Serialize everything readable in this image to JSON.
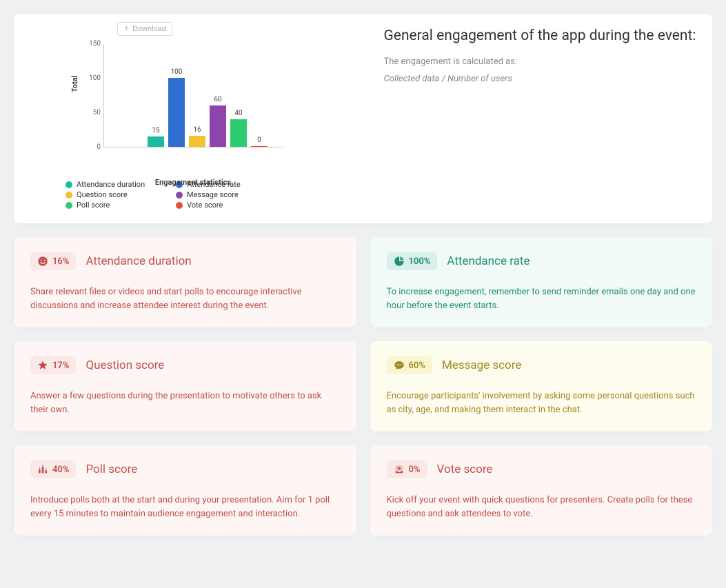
{
  "download_label": "Download",
  "header": {
    "title": "General engagement of the app during the event:",
    "subtitle": "The engagement is calculated as:",
    "formula": "Collected data / Number of users"
  },
  "chart_data": {
    "type": "bar",
    "title": "",
    "xlabel": "Engagement statistics",
    "ylabel": "Total",
    "ylim": [
      0,
      150
    ],
    "yticks": [
      0,
      50,
      100,
      150
    ],
    "series": [
      {
        "name": "Attendance duration",
        "value": 15,
        "color": "#1abc9c"
      },
      {
        "name": "Attendance rate",
        "value": 100,
        "color": "#2f6fd0"
      },
      {
        "name": "Question score",
        "value": 16,
        "color": "#f1c232"
      },
      {
        "name": "Message score",
        "value": 60,
        "color": "#8e44ad"
      },
      {
        "name": "Poll score",
        "value": 40,
        "color": "#2ecc71"
      },
      {
        "name": "Vote score",
        "value": 0,
        "color": "#e74c3c"
      }
    ]
  },
  "cards": [
    {
      "icon": "smile",
      "theme": "red",
      "percent": "16%",
      "title": "Attendance duration",
      "body": "Share relevant files or videos and start polls to encourage interactive discussions and increase attendee interest during the event."
    },
    {
      "icon": "pie",
      "theme": "green",
      "percent": "100%",
      "title": "Attendance rate",
      "body": "To increase engagement, remember to send reminder emails one day and one hour before the event starts."
    },
    {
      "icon": "star",
      "theme": "red",
      "percent": "17%",
      "title": "Question score",
      "body": "Answer a few questions during the presentation to motivate others to ask their own."
    },
    {
      "icon": "chat",
      "theme": "yellow",
      "percent": "60%",
      "title": "Message score",
      "body": "Encourage participants' involvement by asking some personal questions such as city, age, and making them interact in the chat."
    },
    {
      "icon": "bars",
      "theme": "red",
      "percent": "40%",
      "title": "Poll score",
      "body": "Introduce polls both at the start and during your presentation. Aim for 1 poll every 15 minutes to maintain audience engagement and interaction."
    },
    {
      "icon": "inbox",
      "theme": "red",
      "percent": "0%",
      "title": "Vote score",
      "body": "Kick off your event with quick questions for presenters. Create polls for these questions and ask attendees to vote."
    }
  ],
  "colors": {
    "red": "#c0504d",
    "green": "#1f8e74",
    "yellow": "#a08a1f"
  }
}
